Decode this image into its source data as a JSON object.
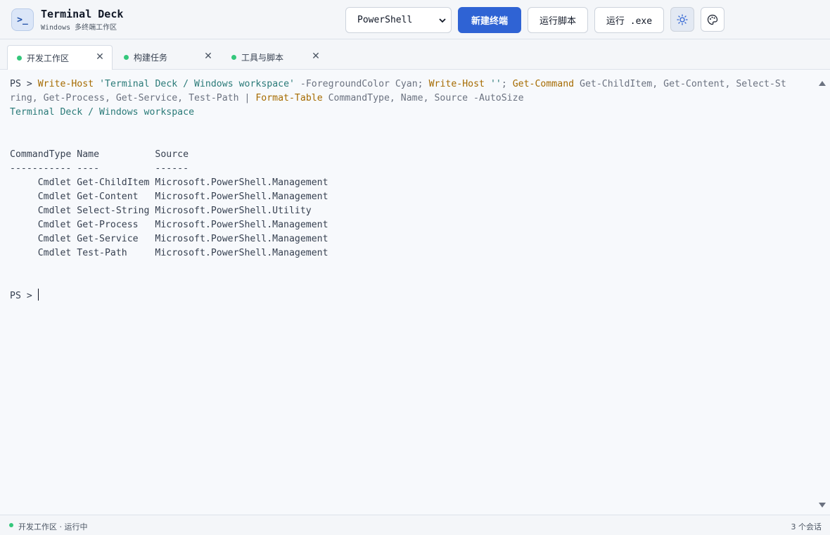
{
  "header": {
    "logo_glyph": ">_",
    "title": "Terminal Deck",
    "subtitle": "Windows 多终端工作区",
    "shell_selected": "PowerShell",
    "new_terminal_label": "新建终端",
    "run_script_label": "运行脚本",
    "run_exe_label": "运行 .exe",
    "theme_icon": "sun-icon",
    "palette_icon": "palette-icon"
  },
  "tabs": [
    {
      "label": "开发工作区",
      "active": true,
      "status_color": "#34c77b"
    },
    {
      "label": "构建任务",
      "active": false,
      "status_color": "#34c77b"
    },
    {
      "label": "工具与脚本",
      "active": false,
      "status_color": "#34c77b"
    }
  ],
  "terminal": {
    "prompt": "PS >",
    "command": {
      "write_host_1": "Write-Host",
      "str_1": "'Terminal Deck / Windows workspace'",
      "arg_fg": "-ForegroundColor",
      "arg_cyan": "Cyan;",
      "write_host_2": "Write-Host",
      "str_2": "''",
      "semicolon": ";",
      "get_command": "Get-Command",
      "args_line1": "Get-ChildItem, Get-Content, Select-St",
      "args_line2": "ring, Get-Process, Get-Service, Test-Path |",
      "format_table": "Format-Table",
      "format_args": "CommandType, Name, Source",
      "autosize": "-AutoSize"
    },
    "output_title": "Terminal Deck / Windows workspace",
    "table_header": "CommandType Name          Source",
    "table_rule": "----------- ----          ------",
    "table_rows": [
      "     Cmdlet Get-ChildItem Microsoft.PowerShell.Management",
      "     Cmdlet Get-Content   Microsoft.PowerShell.Management",
      "     Cmdlet Select-String Microsoft.PowerShell.Utility",
      "     Cmdlet Get-Process   Microsoft.PowerShell.Management",
      "     Cmdlet Get-Service   Microsoft.PowerShell.Management",
      "     Cmdlet Test-Path     Microsoft.PowerShell.Management"
    ],
    "final_prompt": "PS > "
  },
  "status": {
    "left": "开发工作区 · 运行中",
    "right": "3 个会话",
    "dot_color": "#34c77b"
  }
}
